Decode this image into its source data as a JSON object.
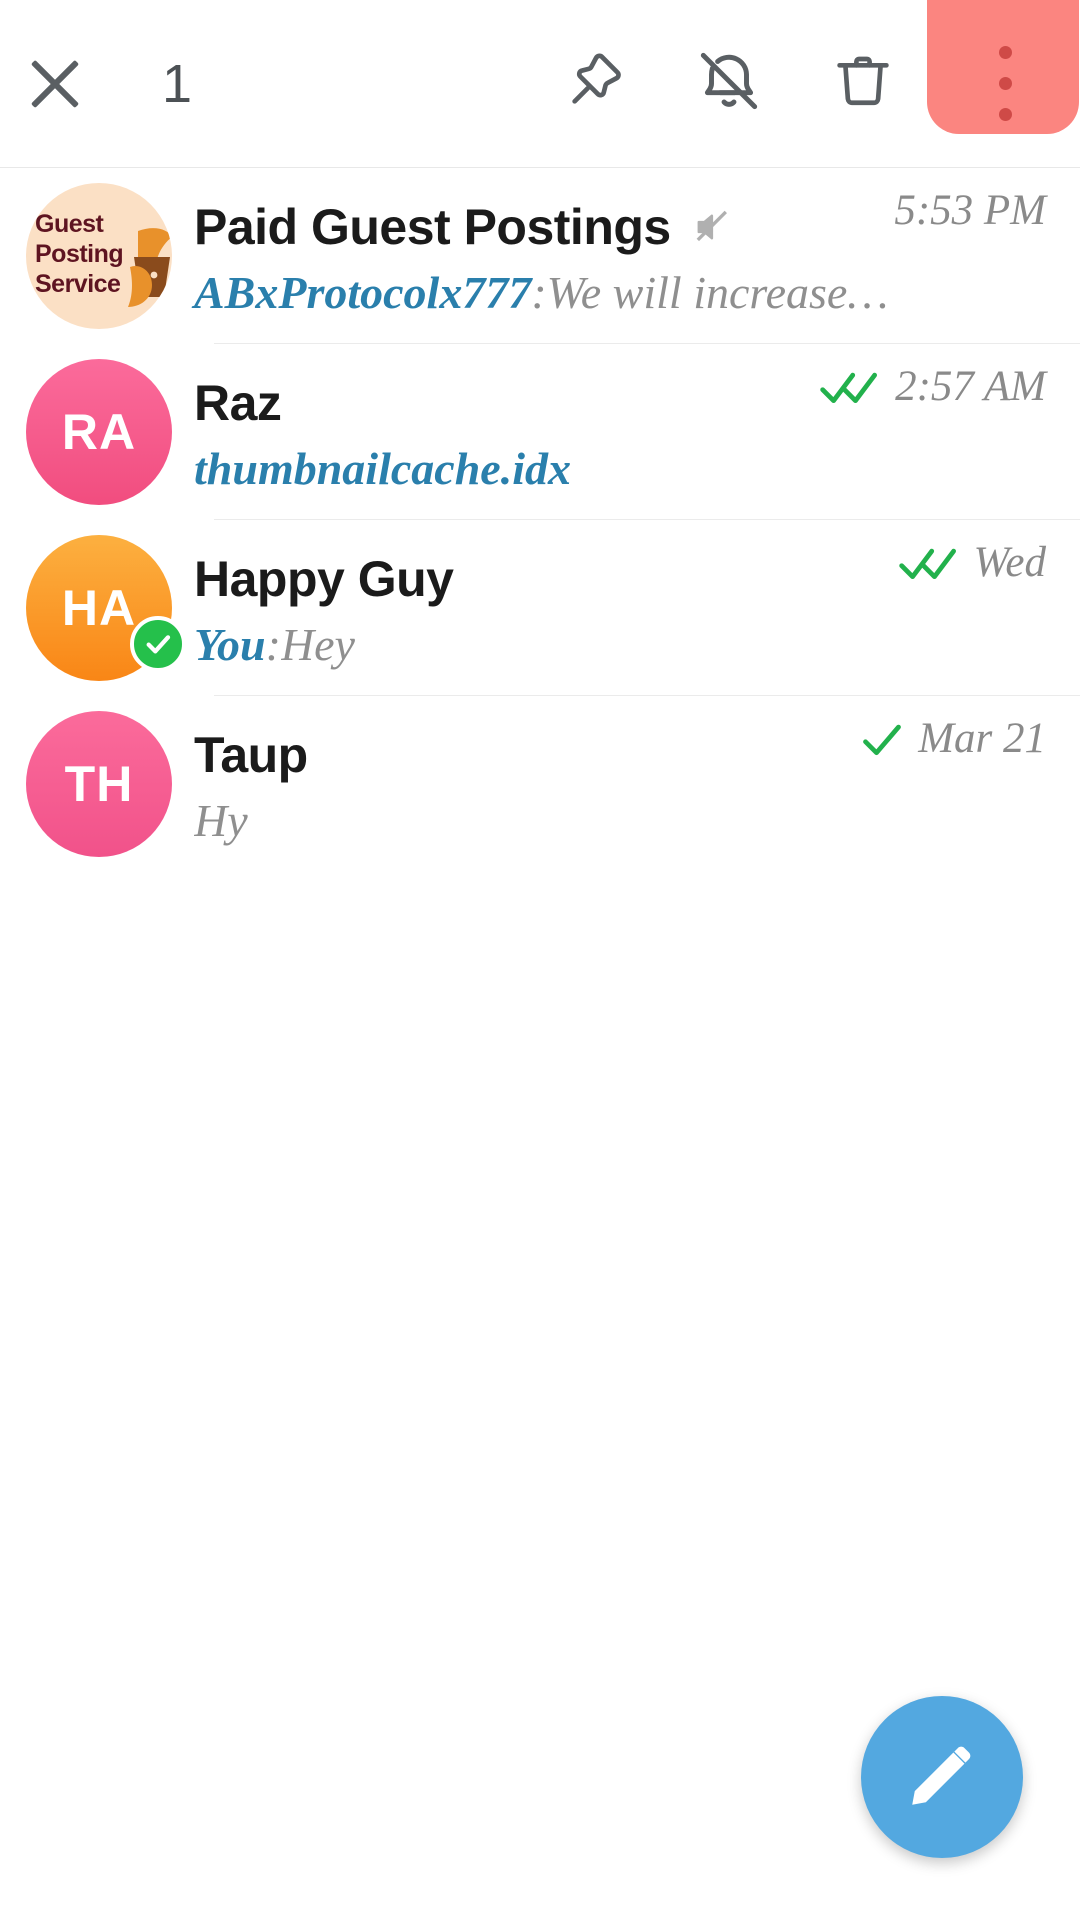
{
  "appbar": {
    "close_icon": "close-icon",
    "selected_count": "1",
    "pin_icon": "pin-icon",
    "mute_icon": "mute-bell-icon",
    "delete_icon": "trash-icon",
    "menu_icon": "overflow-menu-icon",
    "menu_highlight_color": "#fb8580",
    "menu_dot_color": "#cf4a47"
  },
  "chats": [
    {
      "name": "Paid Guest Postings",
      "muted": true,
      "avatar_type": "image",
      "avatar_text_lines": [
        "Guest",
        "Posting",
        "Service"
      ],
      "avatar_bg": "#fbe0c5",
      "avatar_text_color": "#5e1421",
      "sender": "ABxProtocolx777",
      "separator": ": ",
      "preview": "We will increase…",
      "timestamp": "5:53 PM",
      "receipt": "none",
      "online_badge": false
    },
    {
      "name": "Raz",
      "muted": false,
      "avatar_type": "initials",
      "avatar_initials": "RA",
      "avatar_bg": "#f1528a",
      "sender": "",
      "separator": "",
      "preview": "thumbnailcache.idx",
      "preview_is_file": true,
      "timestamp": "2:57 AM",
      "receipt": "double",
      "online_badge": false
    },
    {
      "name": "Happy Guy",
      "muted": false,
      "avatar_type": "initials",
      "avatar_initials": "HA",
      "avatar_bg": "#f98616",
      "sender": "You",
      "separator": ": ",
      "preview": "Hey",
      "timestamp": "Wed",
      "receipt": "double",
      "online_badge": true,
      "badge_color": "#25c04b"
    },
    {
      "name": "Taup",
      "muted": false,
      "avatar_type": "initials",
      "avatar_initials": "TH",
      "avatar_bg": "#f1528a",
      "sender": "",
      "separator": "",
      "preview": "Hy",
      "timestamp": "Mar 21",
      "receipt": "single",
      "online_badge": false
    }
  ],
  "fab": {
    "icon": "pencil-icon",
    "color": "#53a8e0"
  },
  "colors": {
    "accent_blue": "#2a7fac",
    "tick_green": "#22b14c",
    "text_primary": "#1b1b1b",
    "text_secondary": "#8f8f8f"
  }
}
